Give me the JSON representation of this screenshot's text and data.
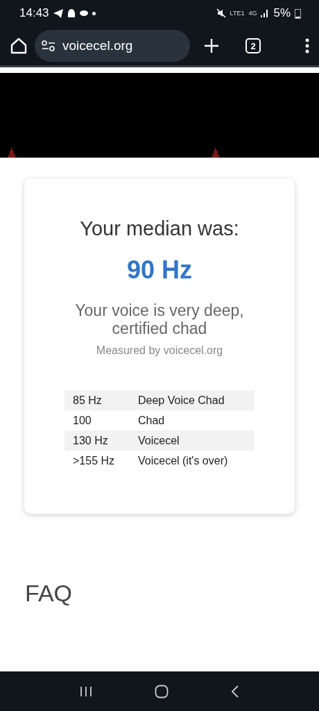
{
  "status_bar": {
    "time": "14:43",
    "network": "4G",
    "volte": "LTE1",
    "battery": "5%"
  },
  "browser": {
    "url": "voicecel.org",
    "tab_count": "2"
  },
  "result": {
    "heading": "Your median was:",
    "value": "90 Hz",
    "verdict": "Your voice is very deep, certified chad",
    "credit": "Measured by voicecel.org",
    "table": [
      [
        "85 Hz",
        "Deep Voice Chad"
      ],
      [
        "100",
        "Chad"
      ],
      [
        "130 Hz",
        "Voicecel"
      ],
      [
        ">155 Hz",
        "Voicecel (it's over)"
      ]
    ]
  },
  "faq": {
    "title": "FAQ"
  }
}
